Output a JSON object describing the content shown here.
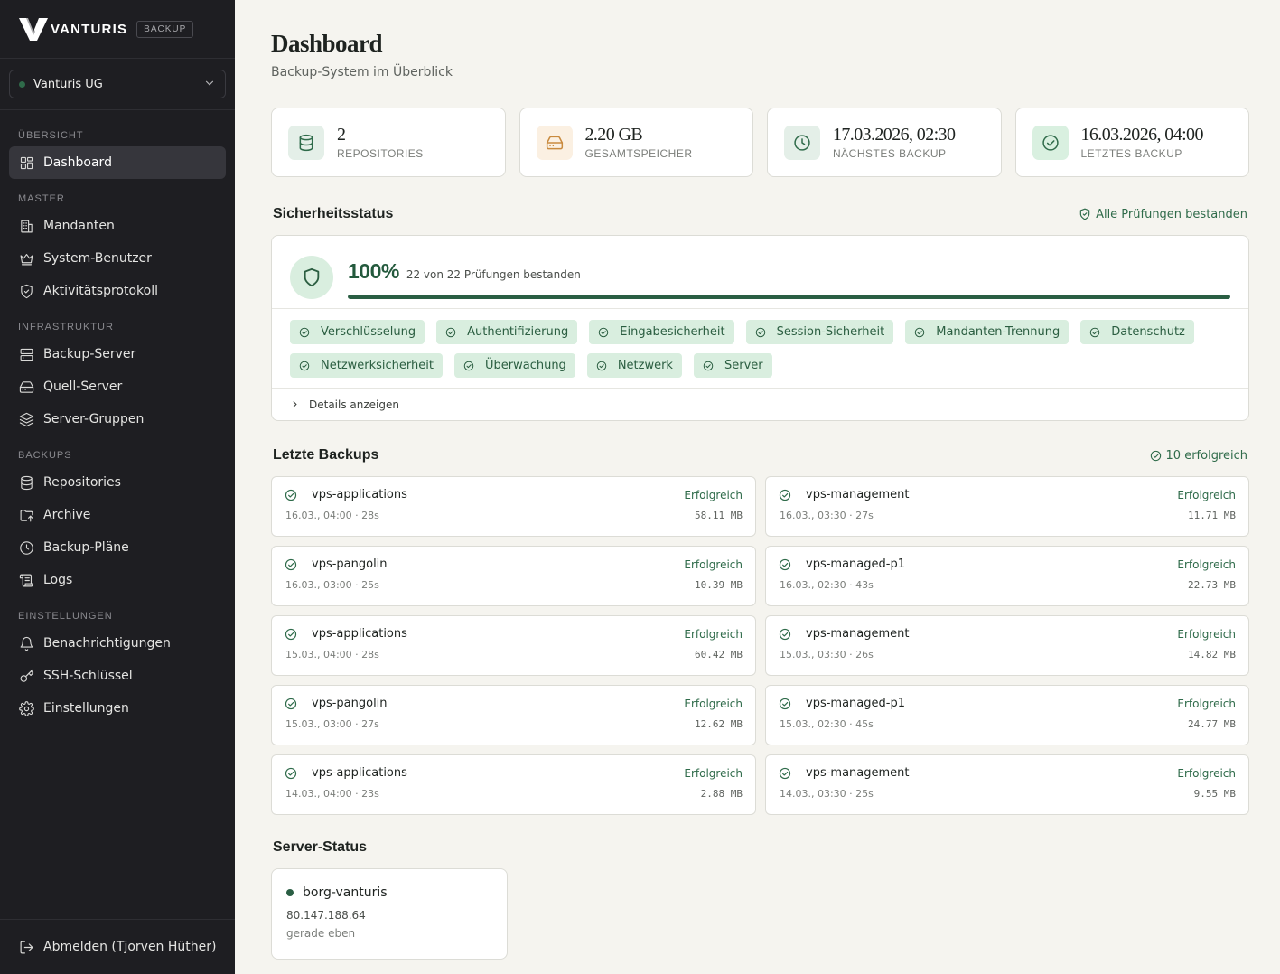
{
  "brand": {
    "name": "VANTURIS",
    "tag": "BACKUP"
  },
  "tenant": {
    "label": "Vanturis UG"
  },
  "nav": [
    {
      "section": "ÜBERSICHT",
      "items": [
        {
          "label": "Dashboard",
          "icon": "dashboard-icon",
          "active": true
        }
      ]
    },
    {
      "section": "MASTER",
      "items": [
        {
          "label": "Mandanten",
          "icon": "building-icon"
        },
        {
          "label": "System-Benutzer",
          "icon": "crown-icon"
        },
        {
          "label": "Aktivitätsprotokoll",
          "icon": "shield-check-icon"
        }
      ]
    },
    {
      "section": "INFRASTRUKTUR",
      "items": [
        {
          "label": "Backup-Server",
          "icon": "server-icon"
        },
        {
          "label": "Quell-Server",
          "icon": "hard-drive-icon"
        },
        {
          "label": "Server-Gruppen",
          "icon": "layers-icon"
        }
      ]
    },
    {
      "section": "BACKUPS",
      "items": [
        {
          "label": "Repositories",
          "icon": "database-icon"
        },
        {
          "label": "Archive",
          "icon": "folder-icon"
        },
        {
          "label": "Backup-Pläne",
          "icon": "clock-icon"
        },
        {
          "label": "Logs",
          "icon": "scroll-icon"
        }
      ]
    },
    {
      "section": "EINSTELLUNGEN",
      "items": [
        {
          "label": "Benachrichtigungen",
          "icon": "bell-icon"
        },
        {
          "label": "SSH-Schlüssel",
          "icon": "key-icon"
        },
        {
          "label": "Einstellungen",
          "icon": "gear-icon"
        }
      ]
    }
  ],
  "logout": {
    "label": "Abmelden (Tjorven Hüther)"
  },
  "page": {
    "title": "Dashboard",
    "subtitle": "Backup-System im Überblick"
  },
  "stats": [
    {
      "value": "2",
      "label": "REPOSITORIES",
      "icon": "database-icon",
      "bg": "#e4efe8",
      "color": "#2f6b4a"
    },
    {
      "value": "2.20 GB",
      "label": "GESAMTSPEICHER",
      "icon": "hard-drive-icon",
      "bg": "#fbf0e2",
      "color": "#c98a3e"
    },
    {
      "value": "17.03.2026, 02:30",
      "label": "NÄCHSTES BACKUP",
      "icon": "clock-icon",
      "bg": "#e4efe8",
      "color": "#2f6b4a"
    },
    {
      "value": "16.03.2026, 04:00",
      "label": "LETZTES BACKUP",
      "icon": "check-circle-icon",
      "bg": "#d9f0e0",
      "color": "#2f6b4a"
    }
  ],
  "security": {
    "title": "Sicherheitsstatus",
    "status": "Alle Prüfungen bestanden",
    "percent": "100%",
    "progress": 1.0,
    "description": "22 von 22 Prüfungen bestanden",
    "checks": [
      "Verschlüsselung",
      "Authentifizierung",
      "Eingabesicherheit",
      "Session-Sicherheit",
      "Mandanten-Trennung",
      "Datenschutz",
      "Netzwerksicherheit",
      "Überwachung",
      "Netzwerk",
      "Server"
    ],
    "details_label": "Details anzeigen"
  },
  "backups": {
    "title": "Letzte Backups",
    "summary": "10 erfolgreich",
    "items": [
      {
        "name": "vps-applications",
        "status": "Erfolgreich",
        "meta": "16.03., 04:00 · 28s",
        "size": "58.11 MB"
      },
      {
        "name": "vps-management",
        "status": "Erfolgreich",
        "meta": "16.03., 03:30 · 27s",
        "size": "11.71 MB"
      },
      {
        "name": "vps-pangolin",
        "status": "Erfolgreich",
        "meta": "16.03., 03:00 · 25s",
        "size": "10.39 MB"
      },
      {
        "name": "vps-managed-p1",
        "status": "Erfolgreich",
        "meta": "16.03., 02:30 · 43s",
        "size": "22.73 MB"
      },
      {
        "name": "vps-applications",
        "status": "Erfolgreich",
        "meta": "15.03., 04:00 · 28s",
        "size": "60.42 MB"
      },
      {
        "name": "vps-management",
        "status": "Erfolgreich",
        "meta": "15.03., 03:30 · 26s",
        "size": "14.82 MB"
      },
      {
        "name": "vps-pangolin",
        "status": "Erfolgreich",
        "meta": "15.03., 03:00 · 27s",
        "size": "12.62 MB"
      },
      {
        "name": "vps-managed-p1",
        "status": "Erfolgreich",
        "meta": "15.03., 02:30 · 45s",
        "size": "24.77 MB"
      },
      {
        "name": "vps-applications",
        "status": "Erfolgreich",
        "meta": "14.03., 04:00 · 23s",
        "size": "2.88 MB"
      },
      {
        "name": "vps-management",
        "status": "Erfolgreich",
        "meta": "14.03., 03:30 · 25s",
        "size": "9.55 MB"
      }
    ]
  },
  "server_status": {
    "title": "Server-Status",
    "servers": [
      {
        "name": "borg-vanturis",
        "ip": "80.147.188.64",
        "last_seen": "gerade eben"
      }
    ]
  }
}
